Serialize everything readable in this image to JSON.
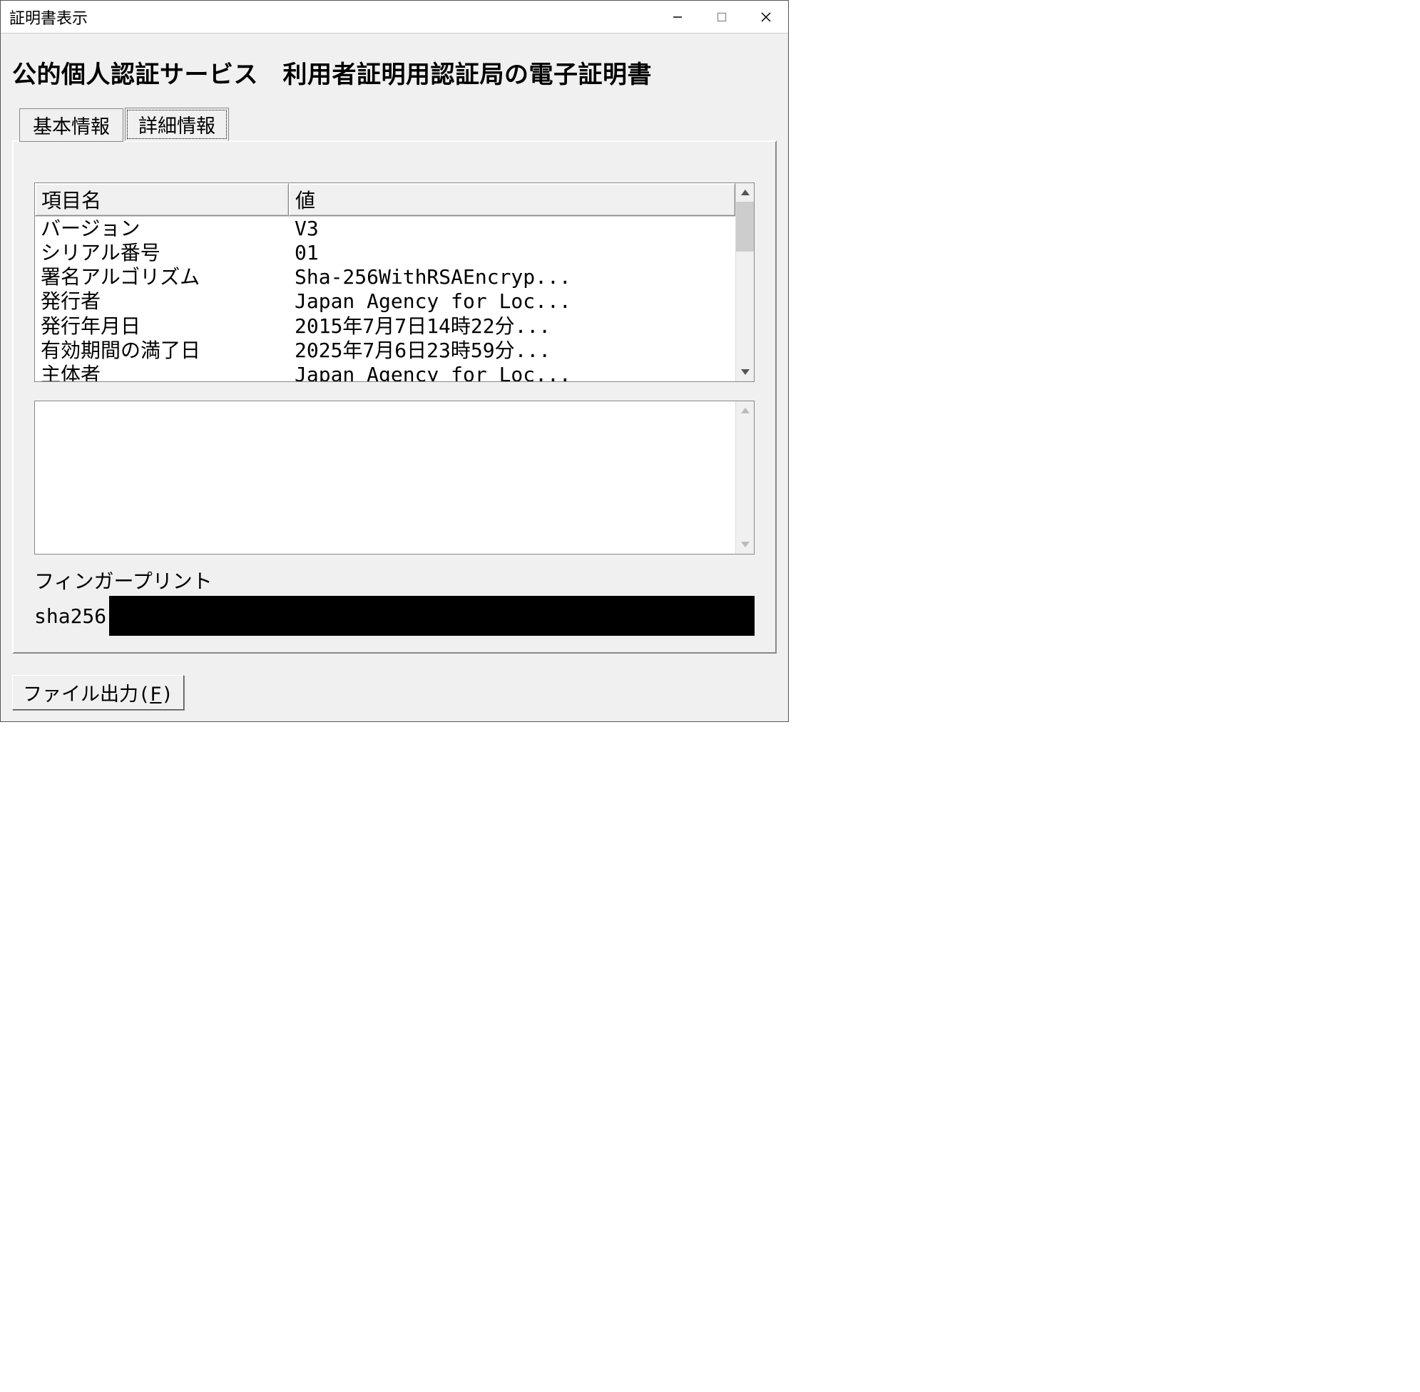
{
  "window": {
    "title": "証明書表示"
  },
  "heading": "公的個人認証サービス　利用者証明用認証局の電子証明書",
  "tabs": {
    "basic": "基本情報",
    "detail": "詳細情報",
    "active": "detail"
  },
  "list": {
    "columns": {
      "name": "項目名",
      "value": "値"
    },
    "rows": [
      {
        "name": "バージョン",
        "value": "V3"
      },
      {
        "name": "シリアル番号",
        "value": "01"
      },
      {
        "name": "署名アルゴリズム",
        "value": "Sha-256WithRSAEncryp..."
      },
      {
        "name": "発行者",
        "value": "Japan Agency for Loc..."
      },
      {
        "name": "発行年月日",
        "value": "2015年7月7日14時22分..."
      },
      {
        "name": "有効期間の満了日",
        "value": "2025年7月6日23時59分..."
      },
      {
        "name": "主体者",
        "value": "Japan Agency for Loc..."
      }
    ]
  },
  "detail_text": "",
  "fingerprint": {
    "label": "フィンガープリント",
    "algo": "sha256",
    "value_redacted": true
  },
  "buttons": {
    "file_output_prefix": "ファイル出力(",
    "file_output_key": "F",
    "file_output_suffix": ")"
  }
}
